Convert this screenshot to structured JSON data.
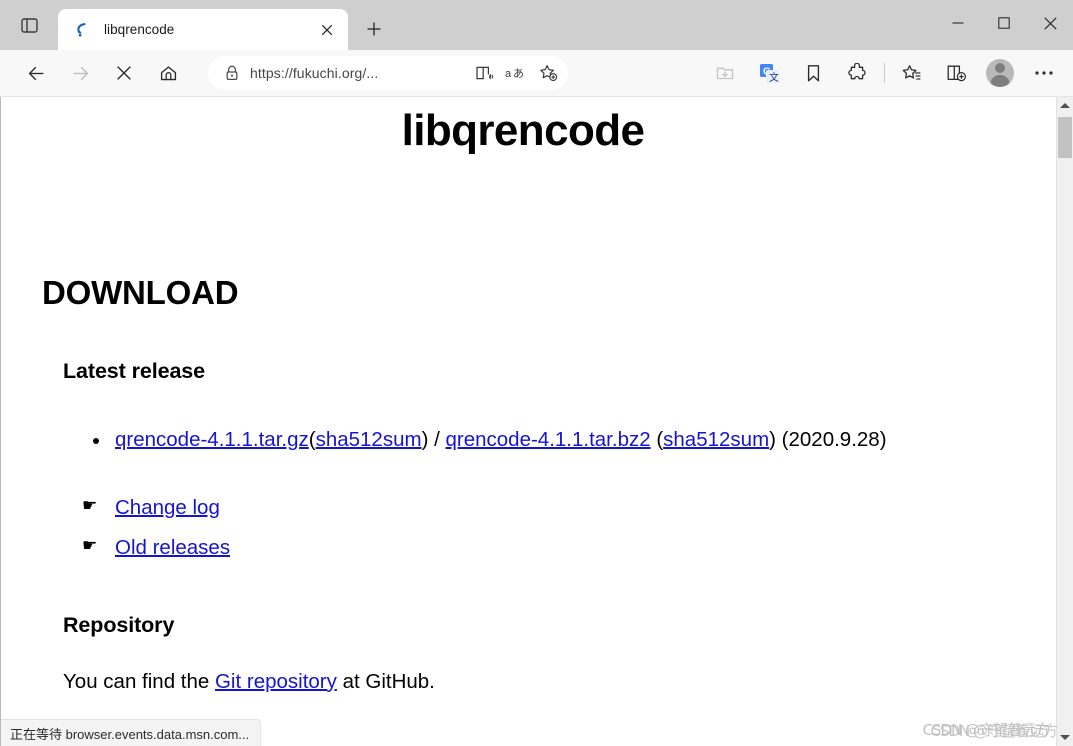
{
  "window": {
    "controls": {
      "minimize": "minimize-button",
      "maximize": "maximize-button",
      "close": "close-button"
    }
  },
  "tabstrip": {
    "tab_search_icon": "tab-search-icon",
    "new_tab_label": "+",
    "tabs": [
      {
        "title": "libqrencode",
        "favicon": "libqrencode-favicon",
        "active": true,
        "close_label": "×"
      }
    ]
  },
  "toolbar": {
    "back_icon": "back-arrow-icon",
    "forward_icon": "forward-arrow-icon",
    "stop_icon": "stop-loading-icon",
    "home_icon": "home-icon",
    "address": {
      "lock_icon": "lock-icon",
      "url": "https://fukuchi.org/...",
      "url_scheme": "https://",
      "url_host": "fukuchi.org/...",
      "read_aloud_icon": "read-aloud-icon",
      "translate_text_icon": "text-preferences-icon",
      "favorites_add_icon": "add-favorite-icon"
    },
    "right_icons": [
      {
        "name": "collections-download-icon",
        "label": ""
      },
      {
        "name": "google-translate-icon",
        "label": "G"
      },
      {
        "name": "favorites-bookmark-icon",
        "label": ""
      },
      {
        "name": "extensions-puzzle-icon",
        "label": ""
      },
      {
        "name": "collections-icon",
        "label": ""
      },
      {
        "name": "split-screen-icon",
        "label": ""
      },
      {
        "name": "profile-avatar",
        "label": ""
      },
      {
        "name": "settings-more-icon",
        "label": "…"
      }
    ]
  },
  "page": {
    "title": "libqrencode",
    "download_heading": "DOWNLOAD",
    "latest_release_heading": "Latest release",
    "release": {
      "targz_link": "qrencode-4.1.1.tar.gz",
      "open_paren": "(",
      "sha_targz": "sha512sum",
      "close_paren_slash": ") / ",
      "tarbz2_link": "qrencode-4.1.1.tar.bz2",
      "open_paren2": " (",
      "sha_tarbz2": "sha512sum",
      "close_paren2": ") ",
      "date": "(2020.9.28)"
    },
    "hand_links": [
      {
        "glyph": "☛",
        "label": "Change log"
      },
      {
        "glyph": "☛",
        "label": "Old releases"
      }
    ],
    "repository_heading": "Repository",
    "repository_text_before": "You can find the ",
    "repository_link": "Git repository",
    "repository_text_after": " at GitHub."
  },
  "scrollbar": {
    "up_arrow": "scroll-up-arrow",
    "down_arrow": "scroll-down-arrow",
    "thumb": "scroll-thumb"
  },
  "statusbar": {
    "text": "正在等待 browser.events.data.msn.com..."
  },
  "watermark": {
    "text": "CSDN @守望着远方",
    "text2": "CSDN @守望着远方"
  },
  "colors": {
    "link": "#1414d2",
    "titlebar": "#cfcfcf",
    "toolbar": "#f8f8f8",
    "page_bg": "#ffffff",
    "scrollbar_track": "#f0f0f0",
    "scrollbar_thumb": "#c2c2c2"
  }
}
